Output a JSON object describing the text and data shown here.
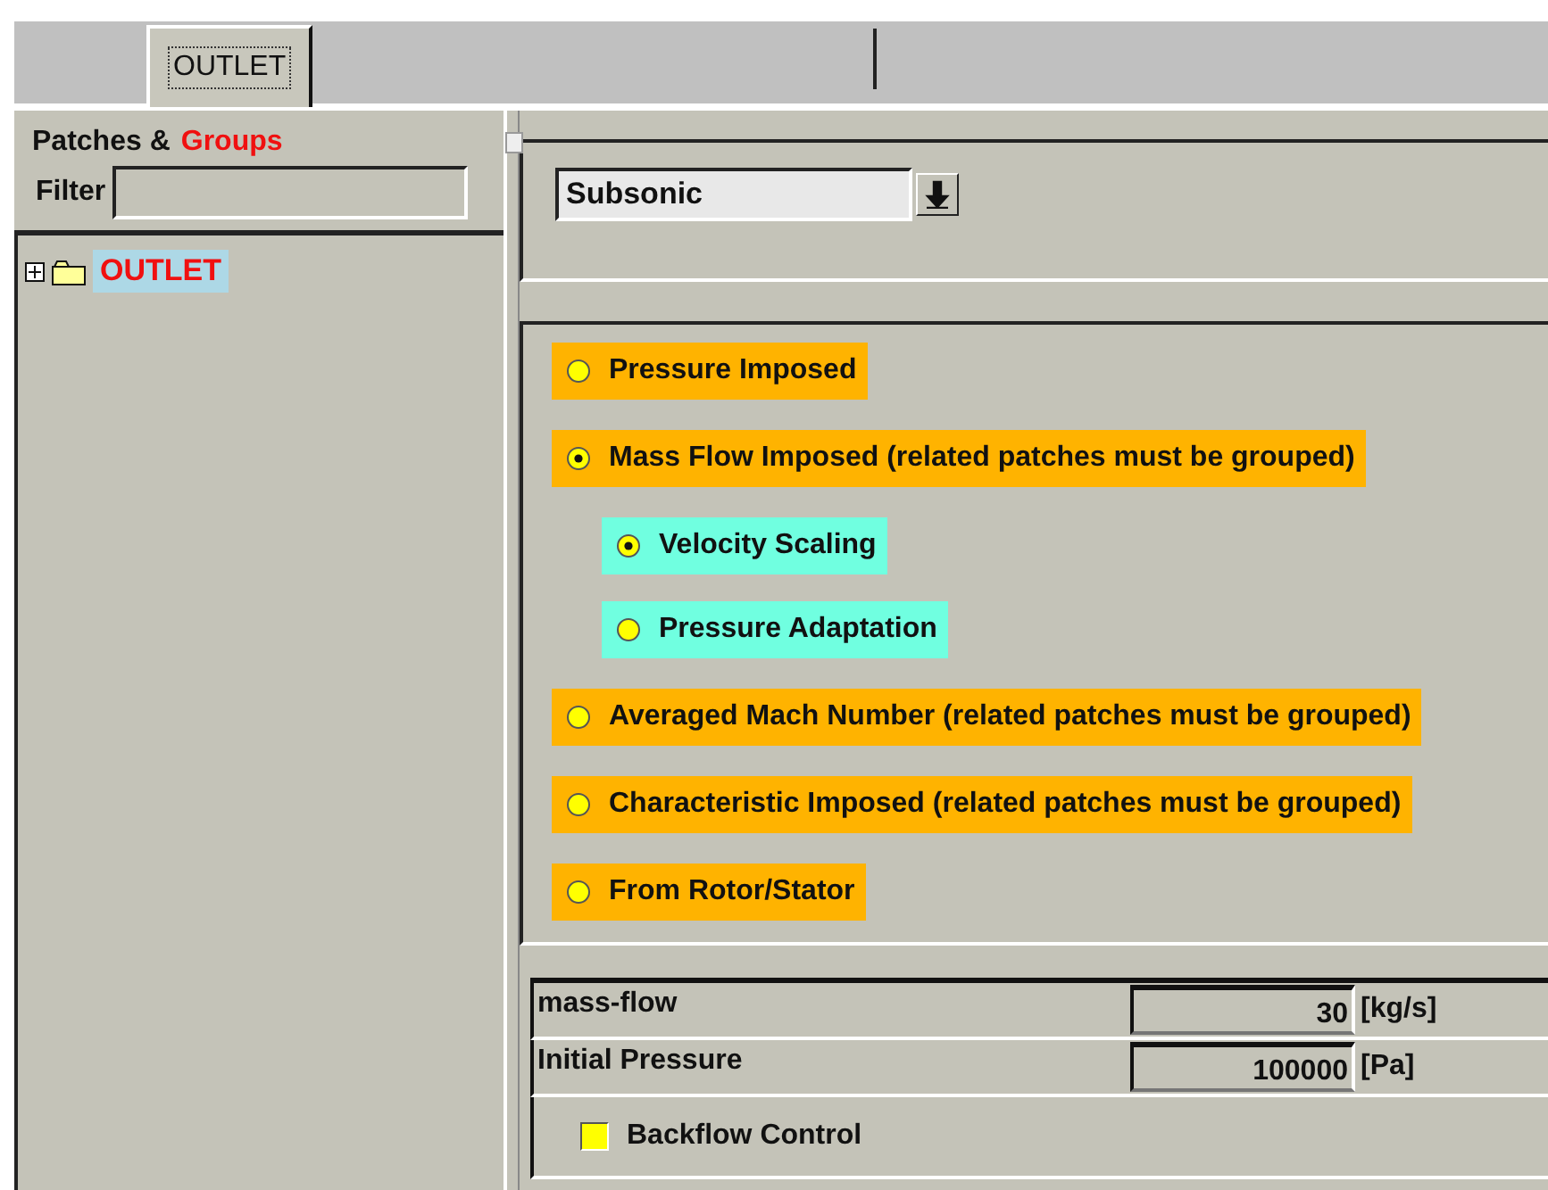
{
  "tabs": [
    {
      "label": "OUTLET",
      "selected": true
    }
  ],
  "sidebar": {
    "title": "Patches &",
    "title_highlight": "Groups",
    "filter": {
      "label": "Filter"
    },
    "tree": [
      {
        "label": "OUTLET",
        "expanded": false,
        "selected": true
      }
    ]
  },
  "flow_type": {
    "value": "Subsonic"
  },
  "options": [
    {
      "label": "Pressure Imposed",
      "selected": false
    },
    {
      "label": "Mass Flow Imposed (related patches must be grouped)",
      "selected": true,
      "children": [
        {
          "label": "Velocity Scaling",
          "selected": true
        },
        {
          "label": "Pressure Adaptation",
          "selected": false
        }
      ]
    },
    {
      "label": "Averaged Mach Number (related patches must be grouped)",
      "selected": false
    },
    {
      "label": "Characteristic Imposed (related patches must be grouped)",
      "selected": false
    },
    {
      "label": "From Rotor/Stator",
      "selected": false
    }
  ],
  "parameters": [
    {
      "label": "mass-flow",
      "value": "30",
      "unit": "[kg/s]"
    },
    {
      "label": "Initial Pressure",
      "value": "100000",
      "unit": "[Pa]"
    }
  ],
  "backflow_control": {
    "label": "Backflow Control",
    "checked": false
  }
}
